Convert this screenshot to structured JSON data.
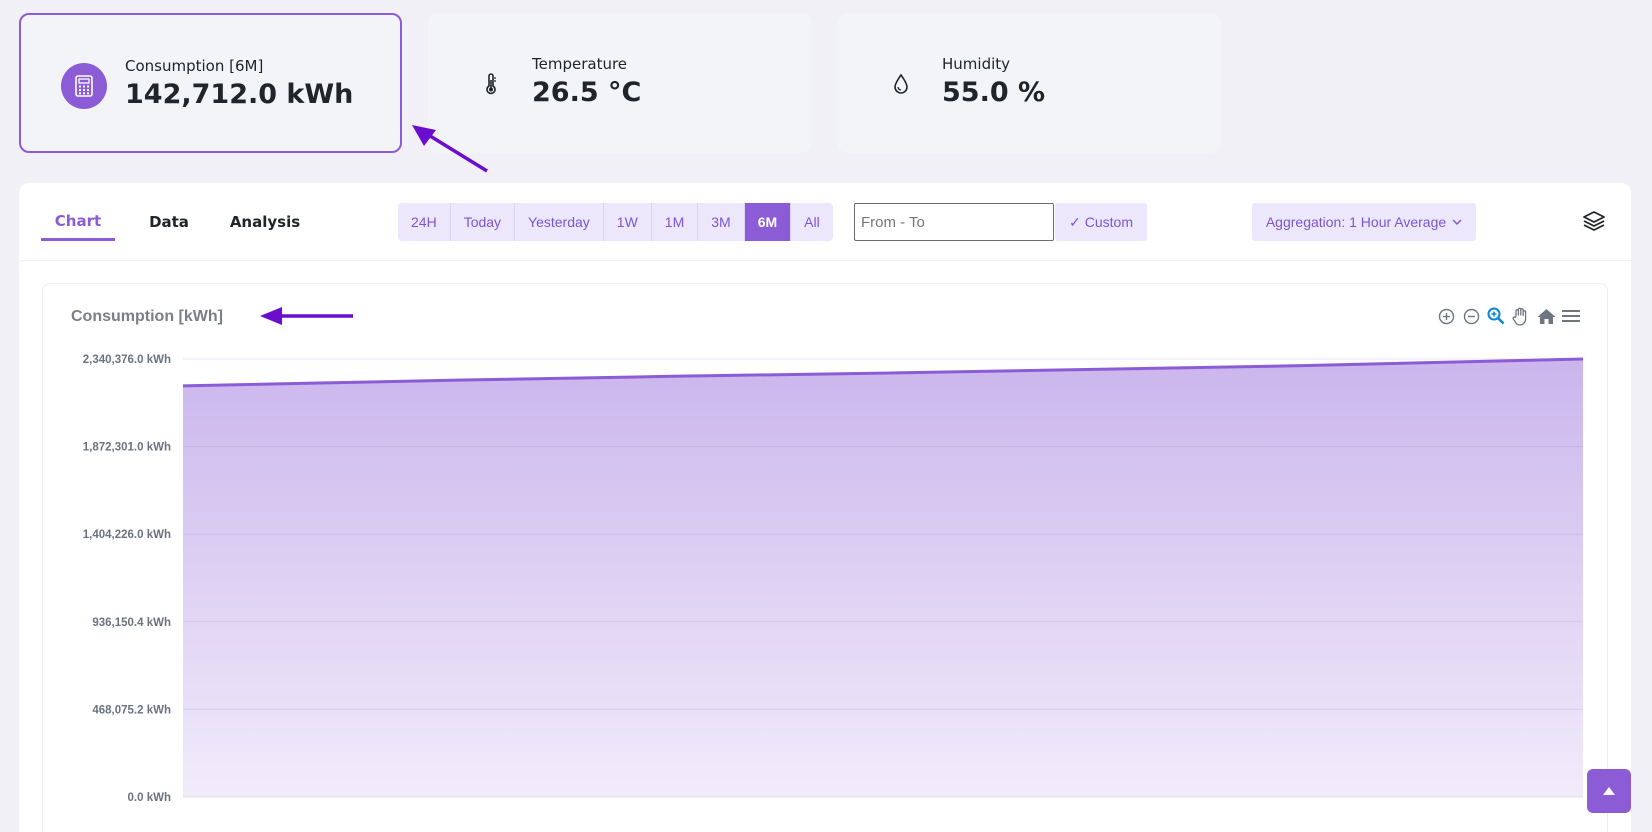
{
  "kpis": {
    "consumption": {
      "label": "Consumption [6M]",
      "value": "142,712.0 kWh",
      "icon": "calculator-icon"
    },
    "temperature": {
      "label": "Temperature",
      "value": "26.5 °C",
      "icon": "thermometer-icon"
    },
    "humidity": {
      "label": "Humidity",
      "value": "55.0 %",
      "icon": "droplet-icon"
    }
  },
  "tabs": [
    "Chart",
    "Data",
    "Analysis"
  ],
  "active_tab": "Chart",
  "ranges": [
    "24H",
    "Today",
    "Yesterday",
    "1W",
    "1M",
    "3M",
    "6M",
    "All"
  ],
  "active_range": "6M",
  "date_range": {
    "placeholder": "From - To",
    "value": ""
  },
  "custom_label": "Custom",
  "aggregation_label": "Aggregation: 1 Hour Average",
  "colors": {
    "accent": "#8b5cd6",
    "annotation_arrow": "#6a0dcc"
  },
  "chart_title": "Consumption [kWh]",
  "chart_data": {
    "type": "area",
    "title": "Consumption [kWh]",
    "unit": "kWh",
    "ylim": [
      0,
      2340376
    ],
    "y_ticks": [
      "0.0 kWh",
      "468,075.2 kWh",
      "936,150.4 kWh",
      "1,404,226.0 kWh",
      "1,872,301.0 kWh",
      "2,340,376.0 kWh"
    ],
    "y_tick_values": [
      0,
      468075.2,
      936150.4,
      1404226,
      1872301,
      2340376
    ],
    "x": [
      0,
      0.2,
      0.35,
      0.5,
      0.65,
      0.8,
      1.0
    ],
    "values": [
      2197000,
      2228000,
      2248000,
      2265000,
      2285000,
      2305000,
      2340376
    ],
    "grid": true,
    "legend": "none"
  }
}
